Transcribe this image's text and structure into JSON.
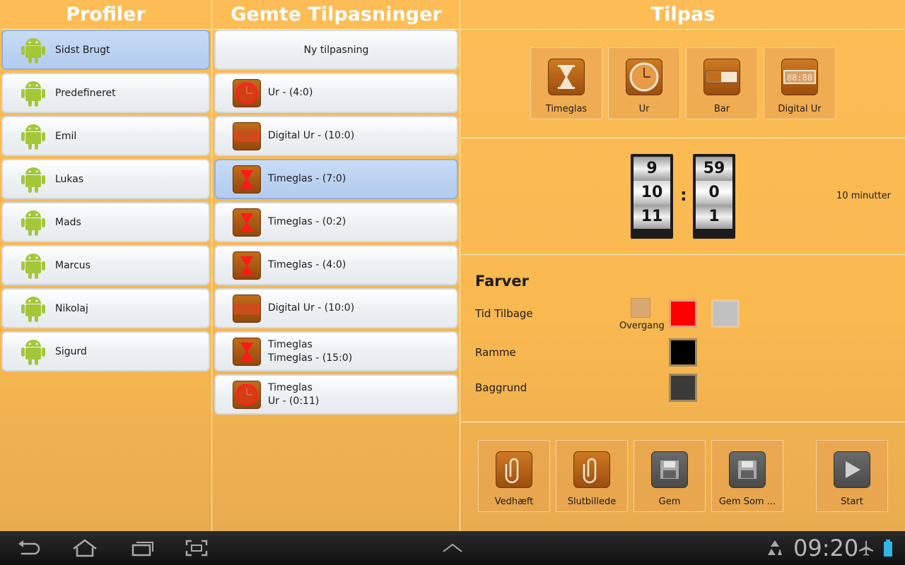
{
  "columns": {
    "profiles_title": "Profiler",
    "saved_title": "Gemte Tilpasninger",
    "tilpas_title": "Tilpas"
  },
  "profiles": [
    {
      "label": "Sidst Brugt",
      "selected": true
    },
    {
      "label": "Predefineret",
      "selected": false
    },
    {
      "label": "Emil",
      "selected": false
    },
    {
      "label": "Lukas",
      "selected": false
    },
    {
      "label": "Mads",
      "selected": false
    },
    {
      "label": "Marcus",
      "selected": false
    },
    {
      "label": "Nikolaj",
      "selected": false
    },
    {
      "label": "Sigurd",
      "selected": false
    }
  ],
  "saved": {
    "new_label": "Ny tilpasning",
    "items": [
      {
        "icon": "clock-icon",
        "line1": "Ur - (4:0)",
        "line2": "",
        "selected": false
      },
      {
        "icon": "digital-clock-icon",
        "line1": "Digital Ur - (10:0)",
        "line2": "",
        "selected": false
      },
      {
        "icon": "hourglass-icon",
        "line1": "Timeglas - (7:0)",
        "line2": "",
        "selected": true
      },
      {
        "icon": "hourglass-icon",
        "line1": "Timeglas - (0:2)",
        "line2": "",
        "selected": false
      },
      {
        "icon": "hourglass-icon",
        "line1": "Timeglas - (4:0)",
        "line2": "",
        "selected": false
      },
      {
        "icon": "digital-clock-icon",
        "line1": "Digital Ur - (10:0)",
        "line2": "",
        "selected": false
      },
      {
        "icon": "hourglass-icon",
        "line1": "Timeglas",
        "line2": "Timeglas - (15:0)",
        "selected": false
      },
      {
        "icon": "clock-icon",
        "line1": "Timeglas",
        "line2": "Ur - (0:11)",
        "selected": false
      }
    ]
  },
  "timer_types": [
    {
      "label": "Timeglas",
      "icon": "hourglass-icon"
    },
    {
      "label": "Ur",
      "icon": "clock-icon"
    },
    {
      "label": "Bar",
      "icon": "progress-bar-icon"
    },
    {
      "label": "Digital Ur",
      "icon": "digital-clock-icon"
    }
  ],
  "time_picker": {
    "minutes": [
      "9",
      "10",
      "11"
    ],
    "seconds": [
      "59",
      "0",
      "1"
    ],
    "separator": ":",
    "summary": "10 minutter"
  },
  "colors": {
    "title": "Farver",
    "tid_tilbage_label": "Tid Tilbage",
    "overgang_label": "Overgang",
    "ramme_label": "Ramme",
    "baggrund_label": "Baggrund",
    "tid_tilbage_color": "#ff0000",
    "tid_tilbage_color2": "#c0c0c0",
    "ramme_color": "#000000",
    "baggrund_color": "#3a3a3a"
  },
  "actions": [
    {
      "label": "Vedhæft",
      "icon": "paperclip-icon"
    },
    {
      "label": "Slutbillede",
      "icon": "paperclip-icon"
    },
    {
      "label": "Gem",
      "icon": "floppy-disk-icon"
    },
    {
      "label": "Gem Som ...",
      "icon": "floppy-disk-icon"
    },
    {
      "label": "Start",
      "icon": "play-icon"
    }
  ],
  "system_bar": {
    "time": "09:20"
  }
}
